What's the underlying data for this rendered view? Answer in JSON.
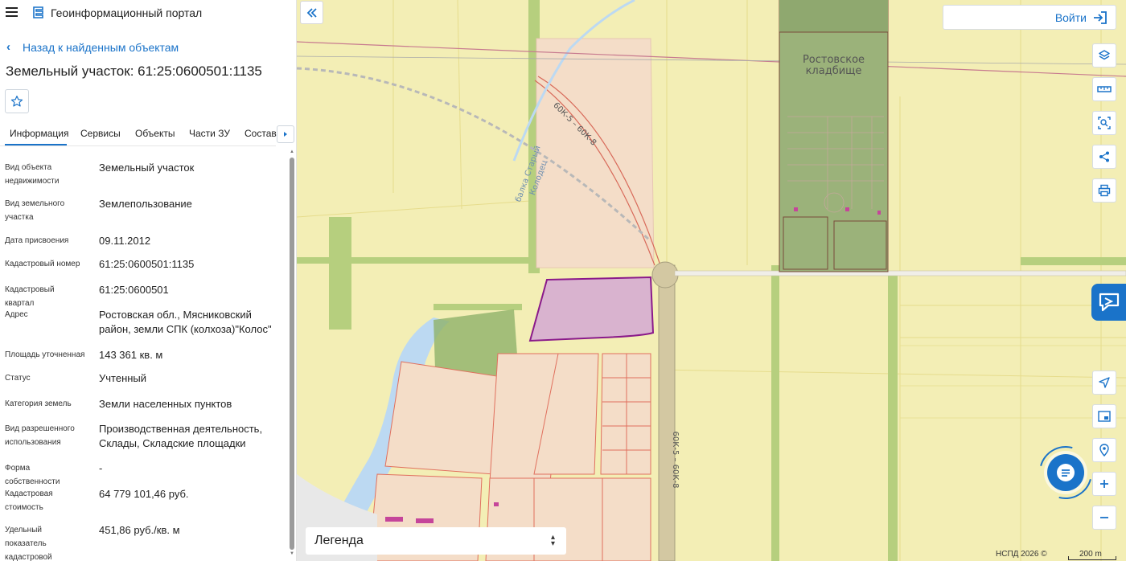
{
  "header": {
    "app_title": "Геоинформационный портал"
  },
  "nav": {
    "back_label": "Назад к найденным объектам"
  },
  "object": {
    "title": "Земельный участок: 61:25:0600501:1135"
  },
  "tabs": [
    {
      "label": "Информация"
    },
    {
      "label": "Сервисы"
    },
    {
      "label": "Объекты"
    },
    {
      "label": "Части ЗУ"
    },
    {
      "label": "Состав"
    }
  ],
  "properties": [
    {
      "label": "Вид объекта недвижимости",
      "value": "Земельный участок"
    },
    {
      "label": "Вид земельного участка",
      "value": "Землепользование"
    },
    {
      "label": "Дата присвоения",
      "value": "09.11.2012"
    },
    {
      "label": "Кадастровый номер",
      "value": "61:25:0600501:1135"
    },
    {
      "label": "Кадастровый квартал",
      "value": "61:25:0600501"
    },
    {
      "label": "Адрес",
      "value": "Ростовская обл., Мясниковский район, земли СПК (колхоза)\"Колос\""
    },
    {
      "label": "Площадь уточненная",
      "value": "143 361 кв. м"
    },
    {
      "label": "Статус",
      "value": "Учтенный"
    },
    {
      "label": "Категория земель",
      "value": "Земли населенных пунктов"
    },
    {
      "label": "Вид разрешенного использования",
      "value": "Производственная деятельность, Склады, Складские площадки"
    },
    {
      "label": "Форма собственности",
      "value": "-"
    },
    {
      "label": "Кадастровая стоимость",
      "value": "64 779 101,46 руб."
    },
    {
      "label": "Удельный показатель кадастровой стоимости",
      "value": "451,86 руб./кв. м"
    }
  ],
  "map": {
    "login_label": "Войти",
    "legend_label": "Легенда",
    "copyright": "НСПД 2026 ©",
    "scale_label": "200 m",
    "labels": {
      "cemetery": "Ростовское кладбище",
      "road_1": "60К-5 – 60К-8",
      "road_2": "60К-5 – 60К-8",
      "stream": "балка Старый Колодец"
    }
  },
  "colors": {
    "accent": "#1a73c9",
    "selected_parcel": "#d9b3cf",
    "selected_parcel_border": "#8a1a8a",
    "background_land": "#f3eeb5"
  }
}
